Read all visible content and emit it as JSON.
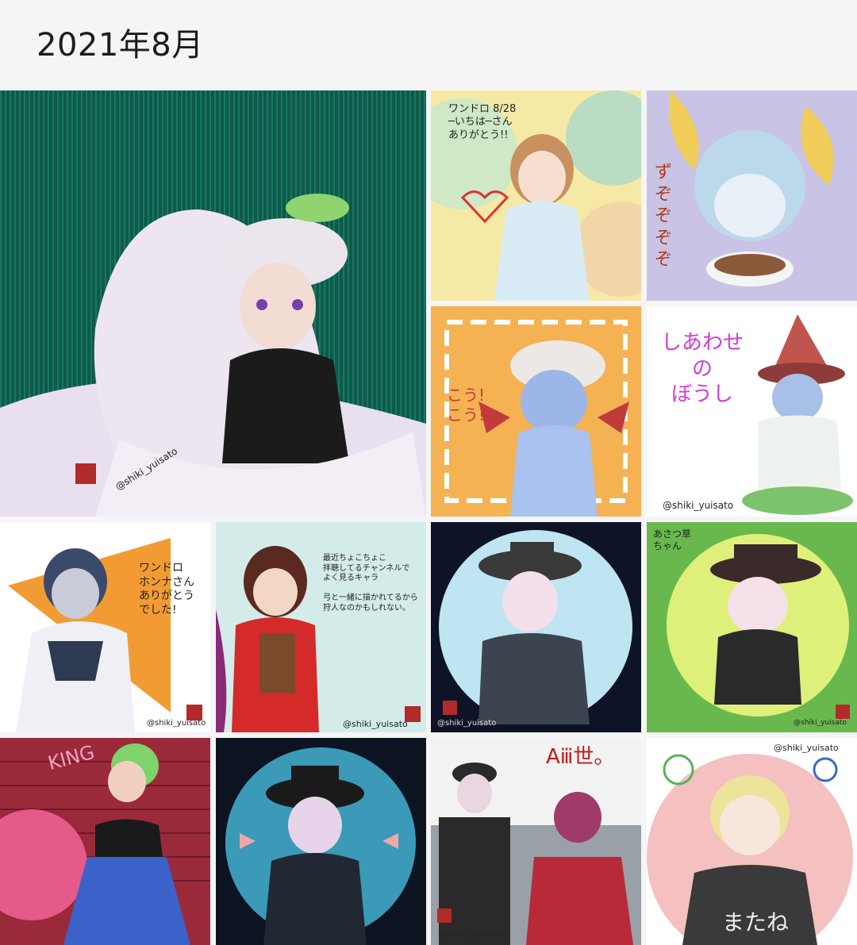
{
  "header": {
    "title": "2021年8月"
  },
  "gallery": {
    "items": [
      {
        "id": "img-1",
        "signature": "@shiki_yuisato"
      },
      {
        "id": "img-2",
        "caption": "ワンドロ 8/28\n─いちは─さん\nありがとう!!"
      },
      {
        "id": "img-3",
        "caption": "ずぞぞぞぞ"
      },
      {
        "id": "img-4",
        "caption": "こう!\nこう!"
      },
      {
        "id": "img-5",
        "caption": "しあわせ\nの\nぼうし",
        "signature": "@shiki_yuisato"
      },
      {
        "id": "img-6",
        "caption": "ワンドロ\nホンナさん\nありがとう\nでした!",
        "signature": "@shiki_yuisato"
      },
      {
        "id": "img-7",
        "caption": "最近ちょこちょこ\n拝聴してるチャンネルで\nよく見るキャラ\n\n弓と一緒に描かれてるから\n狩人なのかもしれない。",
        "signature": "@shiki_yuisato"
      },
      {
        "id": "img-8",
        "signature": "@shiki_yuisato"
      },
      {
        "id": "img-9",
        "caption": "あさつ草\nちゃん",
        "signature": "@shiki_yuisato"
      },
      {
        "id": "img-10",
        "caption": "KING"
      },
      {
        "id": "img-11"
      },
      {
        "id": "img-12",
        "caption": "Aⅲ世。",
        "signature": "@shiki_yuisato"
      },
      {
        "id": "img-13",
        "caption": "またね",
        "signature": "@shiki_yuisato"
      }
    ]
  },
  "colors": {
    "background": "#f5f5f5",
    "title_text": "#1c1c1c"
  }
}
